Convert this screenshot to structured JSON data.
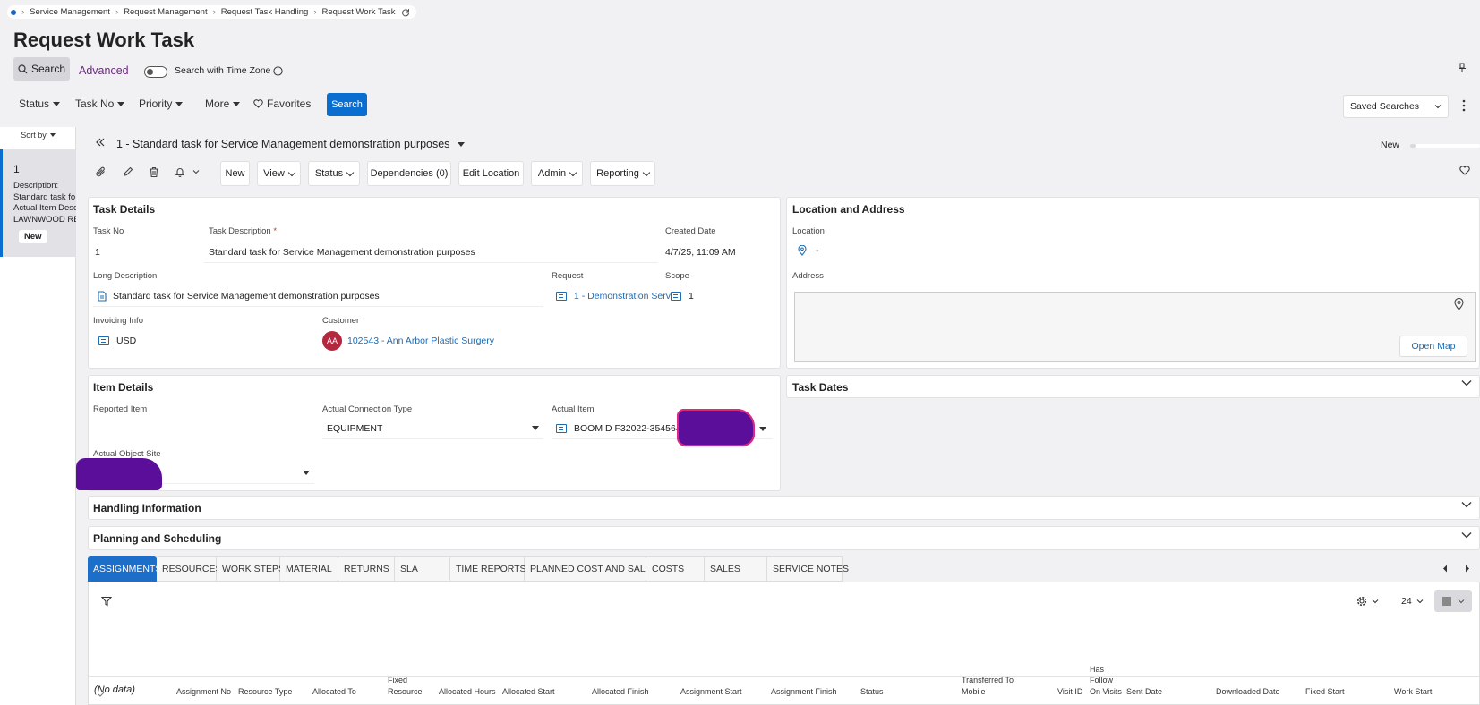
{
  "breadcrumb": [
    "Service Management",
    "Request Management",
    "Request Task Handling",
    "Request Work Task"
  ],
  "page_title": "Request Work Task",
  "search": {
    "search_label": "Search",
    "advanced_label": "Advanced",
    "timezone_label": "Search with Time Zone"
  },
  "filters": {
    "status": "Status",
    "task_no": "Task No",
    "priority": "Priority",
    "more": "More",
    "favorites": "Favorites",
    "search_button": "Search",
    "saved_searches": "Saved Searches"
  },
  "list": {
    "sort_by": "Sort by",
    "items": [
      {
        "number": "1",
        "lines": [
          "Description:",
          "Standard task fo",
          "Actual Item Desc",
          "LAWNWOOD RE"
        ],
        "badge": "New"
      }
    ]
  },
  "record": {
    "title": "1 - Standard task for Service Management demonstration purposes",
    "state": "New",
    "toolbar": {
      "new": "New",
      "view": "View",
      "status": "Status",
      "dependencies": "Dependencies (0)",
      "edit_location": "Edit Location",
      "admin": "Admin",
      "reporting": "Reporting"
    }
  },
  "task_details": {
    "title": "Task Details",
    "task_no_label": "Task No",
    "task_no": "1",
    "task_description_label": "Task Description",
    "task_description": "Standard task for Service Management demonstration purposes",
    "created_date_label": "Created Date",
    "created_date": "4/7/25, 11:09 AM",
    "long_description_label": "Long Description",
    "long_description": "Standard task for Service Management demonstration purposes",
    "request_label": "Request",
    "request": "1 - Demonstration Servi",
    "scope_label": "Scope",
    "scope": "1",
    "invoicing_label": "Invoicing Info",
    "invoicing": "USD",
    "customer_label": "Customer",
    "customer_initials": "AA",
    "customer": "102543 - Ann Arbor Plastic Surgery"
  },
  "location": {
    "title": "Location and Address",
    "location_label": "Location",
    "location_value": "-",
    "address_label": "Address",
    "open_map": "Open Map"
  },
  "item_details": {
    "title": "Item Details",
    "reported_item_label": "Reported Item",
    "connection_type_label": "Actual Connection Type",
    "connection_type": "EQUIPMENT",
    "actual_item_label": "Actual Item",
    "actual_item": "BOOM D F32022-354564",
    "object_site_label": "Actual Object Site"
  },
  "sections": {
    "task_dates": "Task Dates",
    "handling": "Handling Information",
    "planning": "Planning and Scheduling"
  },
  "tabs": [
    "ASSIGNMENTS",
    "RESOURCES",
    "WORK STEPS",
    "MATERIAL",
    "RETURNS",
    "SLA",
    "TIME REPORTS",
    "PLANNED COST AND SALES",
    "COSTS",
    "SALES",
    "SERVICE NOTES"
  ],
  "grid": {
    "page_size": "24",
    "columns": [
      "Assignment No",
      "Resource Type",
      "Allocated To",
      "Fixed Resource",
      "Allocated Hours",
      "Allocated Start",
      "Allocated Finish",
      "Assignment Start",
      "Assignment Finish",
      "Status",
      "Transferred To Mobile",
      "Visit ID",
      "Has Follow On Visits",
      "Sent Date",
      "Downloaded Date",
      "Fixed Start",
      "Work Start"
    ],
    "empty_text": "(No data)"
  }
}
